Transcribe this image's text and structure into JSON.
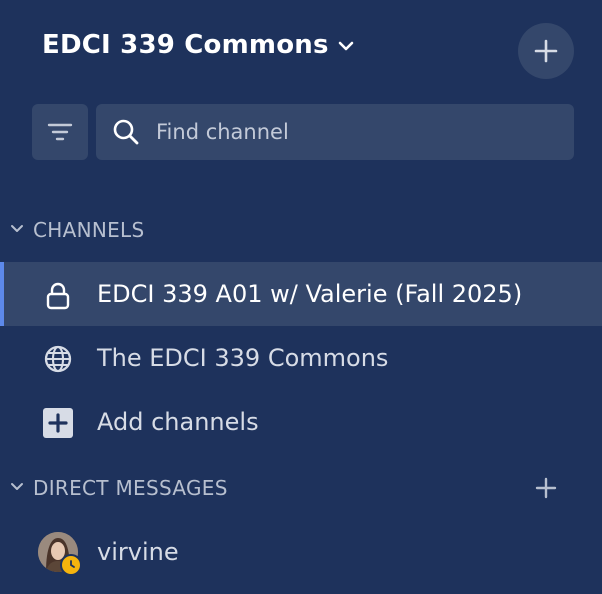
{
  "team": {
    "name": "EDCI 339 Commons",
    "dropdown_icon": "chevron-down-icon"
  },
  "header": {
    "add_icon": "plus-icon"
  },
  "search": {
    "placeholder": "Find channel",
    "icon": "search-icon",
    "filter_icon": "filter-icon"
  },
  "sections": {
    "channels": {
      "label": "CHANNELS",
      "items": [
        {
          "label": "EDCI 339 A01 w/ Valerie (Fall 2025)",
          "icon": "lock-icon",
          "active": true
        },
        {
          "label": "The EDCI 339 Commons",
          "icon": "globe-icon",
          "active": false
        },
        {
          "label": "Add channels",
          "icon": "add-square-icon",
          "active": false
        }
      ]
    },
    "direct_messages": {
      "label": "DIRECT MESSAGES",
      "items": [
        {
          "label": "virvine",
          "status": "away"
        }
      ]
    }
  },
  "colors": {
    "background": "#1e325c",
    "active_row": "#34476b",
    "active_indicator": "#5d89ea",
    "status_away": "#f5b40e"
  }
}
